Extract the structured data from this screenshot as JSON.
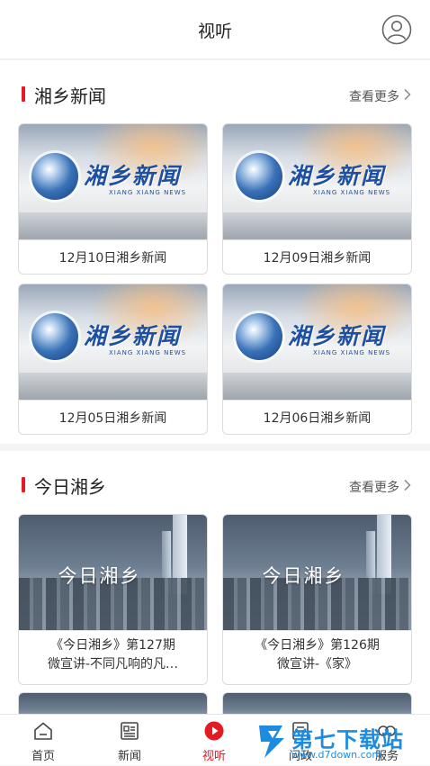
{
  "header": {
    "title": "视听",
    "avatar_icon": "user-circle-icon"
  },
  "sections": [
    {
      "title": "湘乡新闻",
      "more_label": "查看更多",
      "thumb_logo": "湘乡新闻",
      "thumb_sub": "XIANG XIANG NEWS",
      "cards": [
        {
          "caption": "12月10日湘乡新闻"
        },
        {
          "caption": "12月09日湘乡新闻"
        },
        {
          "caption": "12月05日湘乡新闻"
        },
        {
          "caption": "12月06日湘乡新闻"
        }
      ]
    },
    {
      "title": "今日湘乡",
      "more_label": "查看更多",
      "thumb_title": "今日湘乡",
      "cards": [
        {
          "line1": "《今日湘乡》第127期",
          "line2": "微宣讲-不同凡响的凡…"
        },
        {
          "line1": "《今日湘乡》第126期",
          "line2": "微宣讲-《家》"
        }
      ]
    }
  ],
  "tabbar": {
    "tabs": [
      {
        "label": "首页",
        "icon": "home-icon"
      },
      {
        "label": "新闻",
        "icon": "newspaper-icon"
      },
      {
        "label": "视听",
        "icon": "play-circle-icon",
        "active": true
      },
      {
        "label": "问政",
        "icon": "document-icon"
      },
      {
        "label": "服务",
        "icon": "service-icon"
      }
    ]
  },
  "watermark": {
    "text": "第七下载站",
    "url": "www.d7down.com"
  },
  "colors": {
    "accent": "#e21b25",
    "watermark": "#1d8be0"
  }
}
